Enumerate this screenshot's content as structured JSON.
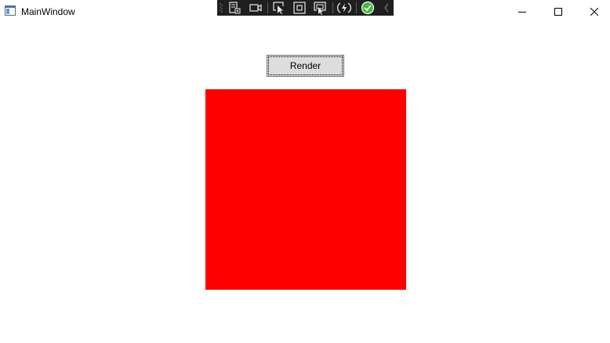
{
  "window": {
    "title": "MainWindow",
    "icon": "window-app-icon"
  },
  "caption_buttons": {
    "minimize_icon": "minimize-icon",
    "maximize_icon": "maximize-icon",
    "close_icon": "close-icon"
  },
  "debug_toolbar": {
    "icons": [
      "live-visual-tree-icon",
      "record-icon",
      "select-element-icon",
      "display-layout-adorners-icon",
      "track-focused-element-icon",
      "hot-reload-icon",
      "binding-failures-ok-icon",
      "collapse-chevron-icon"
    ]
  },
  "toolbar": {
    "render_label": "Render"
  },
  "canvas": {
    "fill_color": "#ff0000"
  },
  "colors": {
    "toolbar_bg": "#1f1f1f",
    "ok_green": "#3fba3f",
    "button_bg": "#dddddd"
  }
}
